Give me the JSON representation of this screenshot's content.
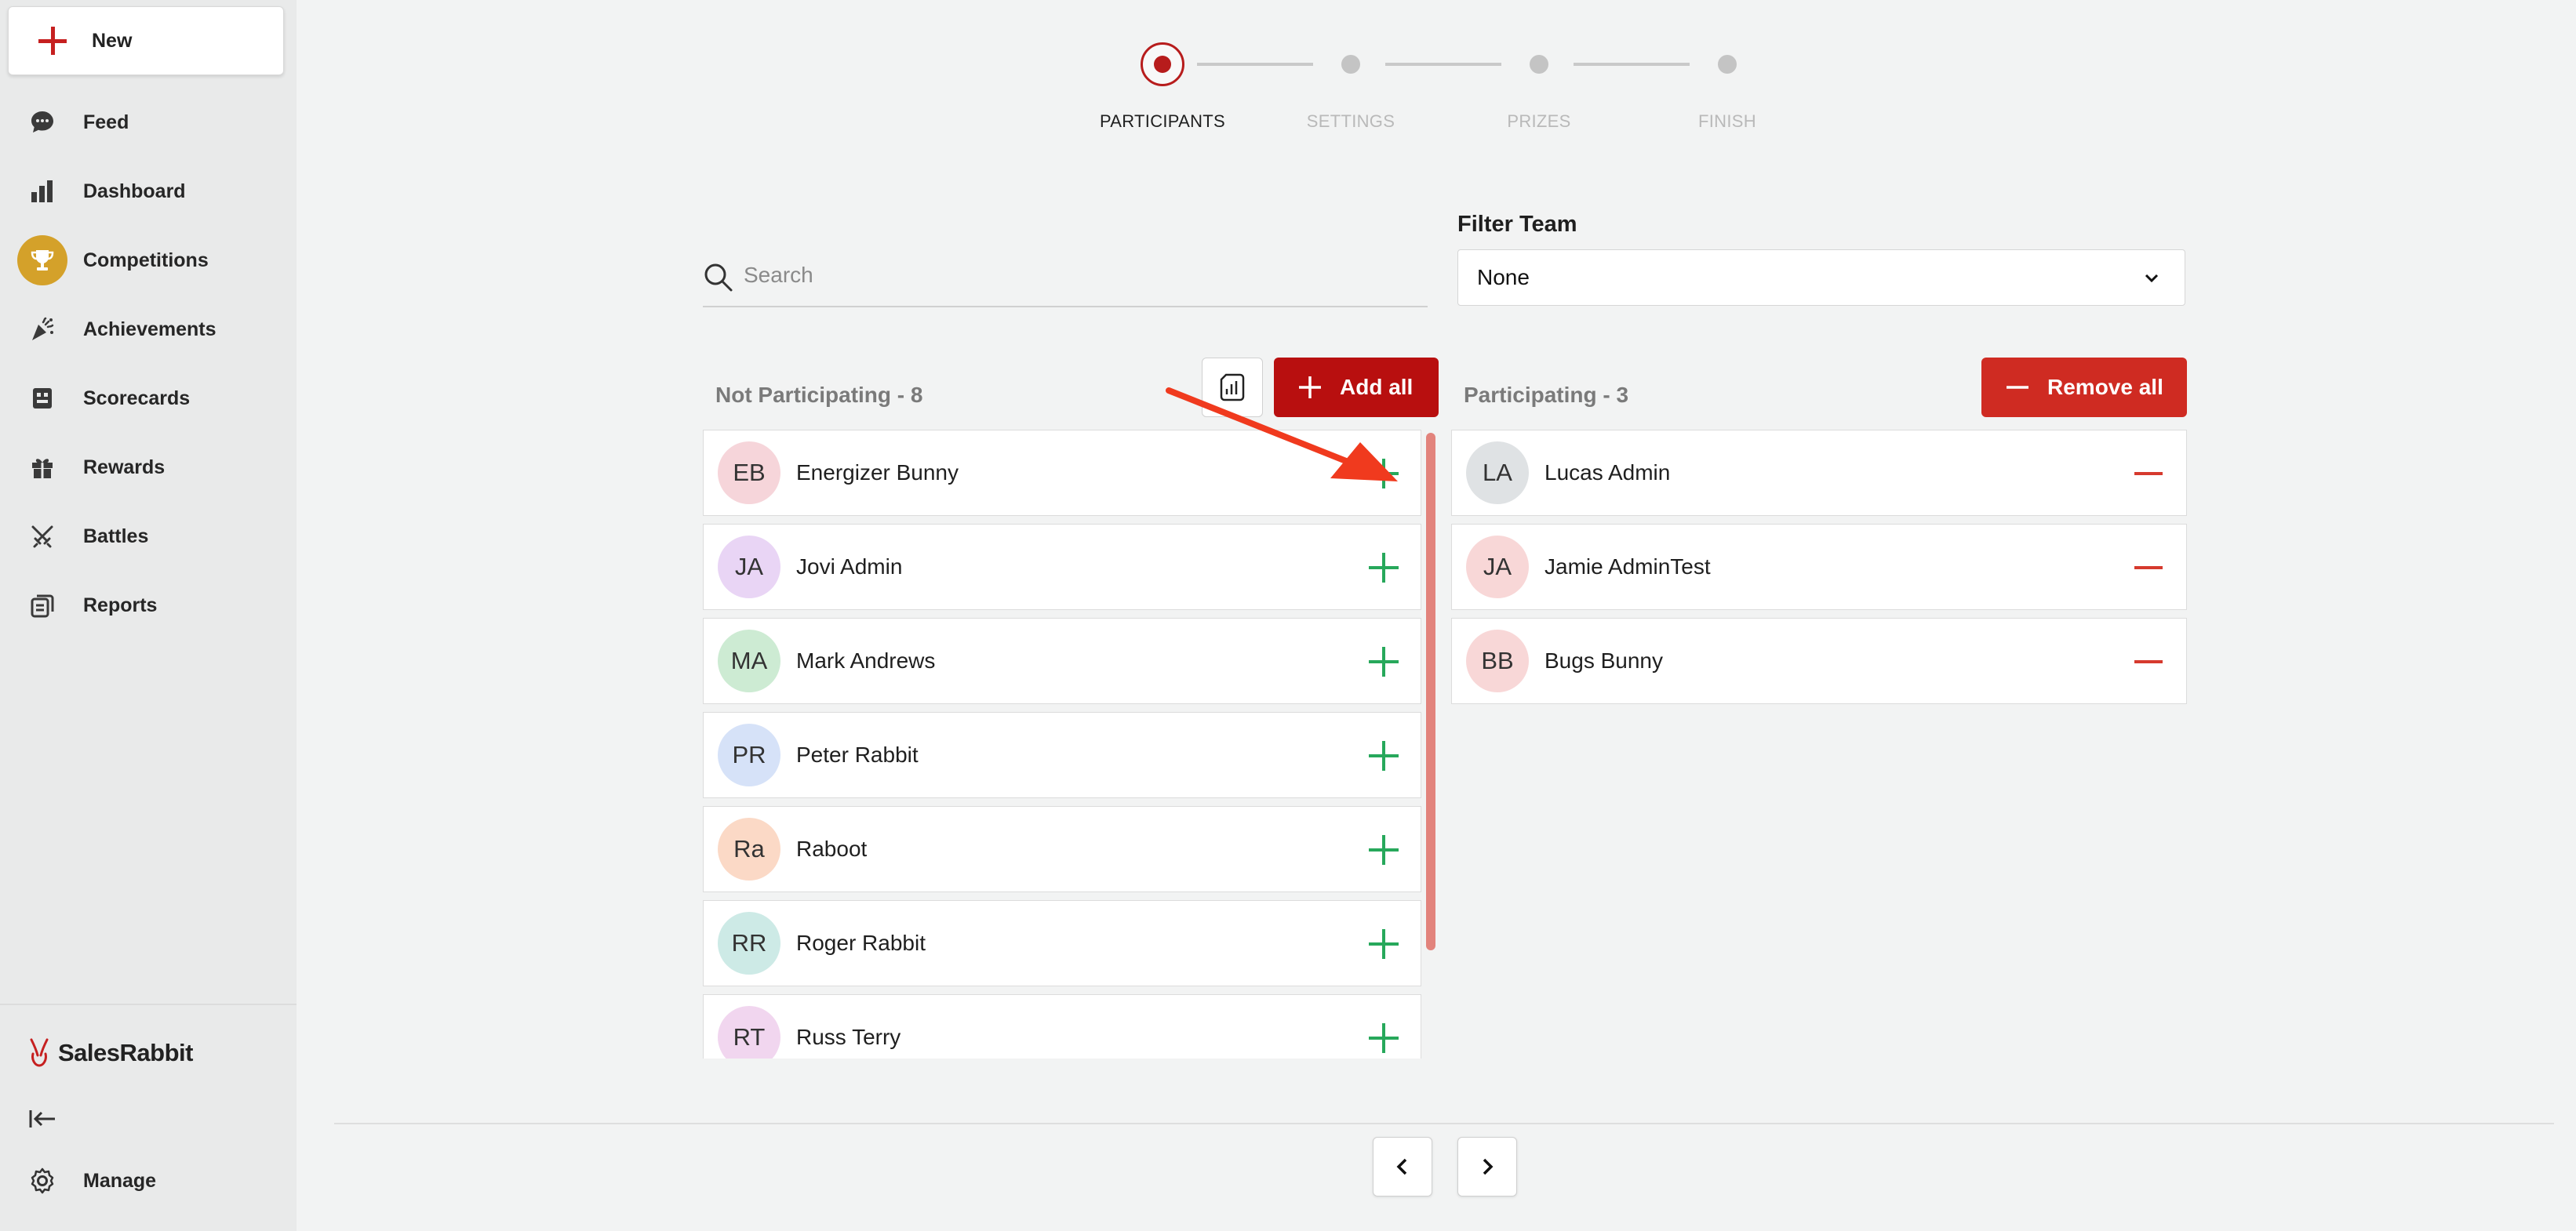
{
  "sidebar": {
    "new_label": "New",
    "items": [
      {
        "label": "Feed",
        "icon": "chat-bubble-icon"
      },
      {
        "label": "Dashboard",
        "icon": "bar-chart-icon"
      },
      {
        "label": "Competitions",
        "icon": "trophy-icon",
        "active": true
      },
      {
        "label": "Achievements",
        "icon": "confetti-icon"
      },
      {
        "label": "Scorecards",
        "icon": "scorecard-icon"
      },
      {
        "label": "Rewards",
        "icon": "gift-icon"
      },
      {
        "label": "Battles",
        "icon": "crossed-swords-icon"
      },
      {
        "label": "Reports",
        "icon": "report-icon"
      }
    ],
    "brand": "SalesRabbit",
    "manage_label": "Manage"
  },
  "stepper": {
    "steps": [
      "PARTICIPANTS",
      "SETTINGS",
      "PRIZES",
      "FINISH"
    ],
    "current": 0
  },
  "search": {
    "placeholder": "Search",
    "value": ""
  },
  "filter": {
    "label": "Filter Team",
    "value": "None"
  },
  "not_participating": {
    "title": "Not Participating - 8",
    "add_all_label": "Add all",
    "people": [
      {
        "initials": "EB",
        "name": "Energizer Bunny",
        "color": "#f6d5da"
      },
      {
        "initials": "JA",
        "name": "Jovi Admin",
        "color": "#e9d5f5"
      },
      {
        "initials": "MA",
        "name": "Mark Andrews",
        "color": "#cdebd3"
      },
      {
        "initials": "PR",
        "name": "Peter Rabbit",
        "color": "#d6e2f8"
      },
      {
        "initials": "Ra",
        "name": "Raboot",
        "color": "#fbd9c6"
      },
      {
        "initials": "RR",
        "name": "Roger Rabbit",
        "color": "#cdeae6"
      },
      {
        "initials": "RT",
        "name": "Russ Terry",
        "color": "#f1d6ef"
      }
    ]
  },
  "participating": {
    "title": "Participating - 3",
    "remove_all_label": "Remove all",
    "people": [
      {
        "initials": "LA",
        "name": "Lucas Admin",
        "color": "#dfe2e4"
      },
      {
        "initials": "JA",
        "name": "Jamie AdminTest",
        "color": "#f8d7d7"
      },
      {
        "initials": "BB",
        "name": "Bugs Bunny",
        "color": "#f8d7d7"
      }
    ]
  },
  "colors": {
    "accent": "#b80f0f",
    "trophy": "#d4a12a",
    "add": "#27a85b",
    "remove": "#d63a2e"
  }
}
